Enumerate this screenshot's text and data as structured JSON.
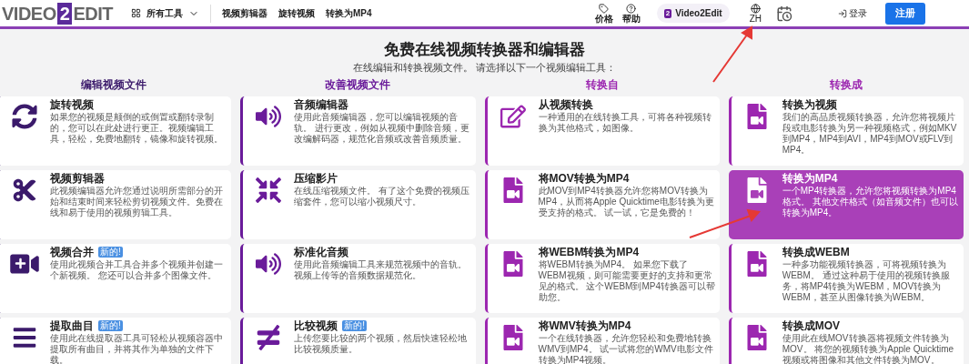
{
  "header": {
    "logo": {
      "left": "VIDEO",
      "middle": "2",
      "right": "EDIT"
    },
    "tools_menu": "所有工具",
    "nav_links": [
      "视频剪辑器",
      "旋转视频",
      "转换为MP4"
    ],
    "price": "价格",
    "help": "帮助",
    "brand_badge": {
      "mark": "2",
      "label": "Video2Edit"
    },
    "language": "ZH",
    "login": "登录",
    "register": "注册"
  },
  "title": "免费在线视频转换器和编辑器",
  "subtitle": "在线编辑和转换视频文件。 请选择以下一个视频编辑工具：",
  "columns": [
    {
      "heading": "编辑视频文件",
      "color": "#3b1a6b",
      "cards": [
        {
          "kind": "rotate",
          "title": "旋转视频",
          "selected": false,
          "description": "如果您的视频是颠倒的或倒置或翻转录制的，您可以在此处进行更正。视频编辑工具，轻松，免费地翻转，镜像和旋转视频。"
        },
        {
          "kind": "scissors",
          "title": "视频剪辑器",
          "selected": false,
          "description": "此视频编辑器允许您通过说明所需部分的开始和结束时间来轻松剪切视频文件。免费在线和易于使用的视频剪辑工具。"
        },
        {
          "kind": "video-plus",
          "title": "视频合并",
          "badge": "新的!",
          "selected": false,
          "description": "使用此视频合并工具合并多个视频并创建一个新视频。 您还可以合并多个图像文件。"
        },
        {
          "kind": "lines",
          "title": "提取曲目",
          "badge": "新的!",
          "selected": false,
          "description": "使用此在线提取器工具可轻松从视频容器中提取所有曲目，并将其作为单独的文件下载。"
        }
      ]
    },
    {
      "heading": "改善视频文件",
      "color": "#6a1b9a",
      "cards": [
        {
          "kind": "speaker",
          "title": "音频编辑器",
          "selected": false,
          "description": "使用此音频编辑器，您可以编辑视频的音轨。 进行更改，例如从视频中删除音频，更改编解码器，规范化音频或改善音频质量。"
        },
        {
          "kind": "compress",
          "title": "压缩影片",
          "selected": false,
          "description": "在线压缩视频文件。 有了这个免费的视频压缩套件，您可以缩小视频尺寸。"
        },
        {
          "kind": "speaker",
          "title": "标准化音频",
          "selected": false,
          "description": "使用此音频编辑工具来规范视频中的音轨。视频上传等的音频数据规范化。"
        },
        {
          "kind": "not-equal",
          "title": "比较视频",
          "badge": "新的!",
          "selected": false,
          "description": "上传您要比较的两个视频，然后快速轻松地比较视频质量。"
        }
      ]
    },
    {
      "heading": "转换自",
      "color": "#9c27b0",
      "cards": [
        {
          "kind": "edit",
          "title": "从视频转换",
          "selected": false,
          "description": "一种通用的在线转换工具，可将各种视频转换为其他格式，如图像。"
        },
        {
          "kind": "file-video",
          "title": "将MOV转换为MP4",
          "selected": false,
          "description": "此MOV到MP4转换器允许您将MOV转换为MP4，从而将Apple Quicktime电影转换为更受支持的格式。 试一试，它是免费的！"
        },
        {
          "kind": "file-video",
          "title": "将WEBM转换为MP4",
          "selected": false,
          "description": "将WEBM转换为MP4。 如果您下载了WEBM视频，则可能需要更好的支持和更常见的格式。 这个WEBM到MP4转换器可以帮助您。"
        },
        {
          "kind": "file-video",
          "title": "将WMV转换为MP4",
          "selected": false,
          "description": "一个在线转换器，允许您轻松和免费地转换WMV到MP4。 试一试将您的WMV电影文件转换为MP4视频。"
        }
      ]
    },
    {
      "heading": "转换成",
      "color": "#9c27b0",
      "cards": [
        {
          "kind": "file-video",
          "title": "转换为视频",
          "selected": false,
          "description": "我们的高品质视频转换器，允许您将视频片段或电影转换为另一种视频格式，例如MKV到MP4，MP4到AVI，MP4到MOV或FLV到MP4。"
        },
        {
          "kind": "file-video",
          "title": "转换为MP4",
          "selected": true,
          "description": "一个MP4转换器，允许您将视频转换为MP4格式。 其他文件格式（如音频文件）也可以转换为MP4。"
        },
        {
          "kind": "file-video",
          "title": "转换成WEBM",
          "selected": false,
          "description": "一种多功能视频转换器，可将视频转换为WEBM。 通过这种易于使用的视频转换服务，将MP4转换为WEBM，MOV转换为WEBM，甚至从图像转换为WEBM。"
        },
        {
          "kind": "file-video",
          "title": "转换成MOV",
          "selected": false,
          "description": "使用此在线MOV转换器将视频文件转换为MOV。 将您的视频转换为Apple Quicktime视频或将图像和其他文件转换为MOV。"
        }
      ]
    }
  ]
}
